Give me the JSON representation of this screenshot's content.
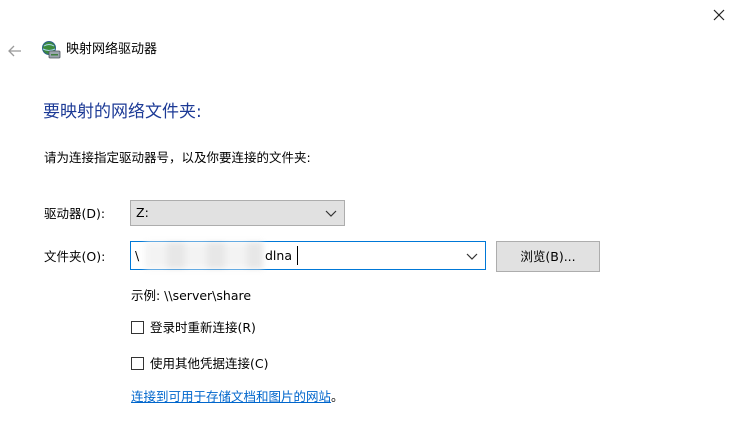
{
  "window": {
    "title": "映射网络驱动器",
    "close_icon": "close-icon",
    "back_icon": "back-arrow-icon",
    "title_icon": "network-drive-icon"
  },
  "heading": "要映射的网络文件夹:",
  "instruction": "请为连接指定驱动器号，以及你要连接的文件夹:",
  "drive": {
    "label": "驱动器(D):",
    "value": "Z:"
  },
  "folder": {
    "label": "文件夹(O):",
    "value_prefix": "\\",
    "value_suffix": "dlna"
  },
  "browse_label": "浏览(B)...",
  "example": "示例: \\\\server\\share",
  "options": {
    "reconnect_label": "登录时重新连接(R)",
    "reconnect_checked": false,
    "other_credentials_label": "使用其他凭据连接(C)",
    "other_credentials_checked": false
  },
  "link": {
    "text": "连接到可用于存储文档和图片的网站",
    "suffix": "。"
  },
  "colors": {
    "heading": "#1c3a96",
    "link": "#0066cc",
    "focus_border": "#0078d7",
    "button_bg": "#e1e1e1"
  }
}
